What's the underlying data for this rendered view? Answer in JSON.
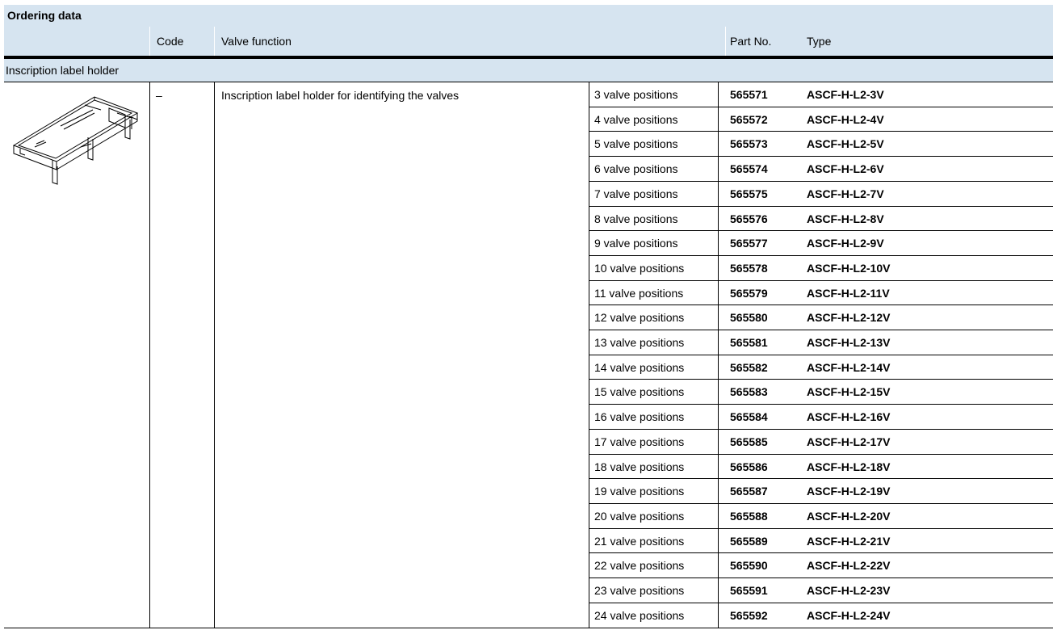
{
  "table": {
    "title": "Ordering data",
    "headers": {
      "code": "Code",
      "valve_function": "Valve function",
      "part_no": "Part No.",
      "type": "Type"
    },
    "section_label": "Inscription label holder",
    "code_value": "–",
    "description": "Inscription label holder for identifying the valves",
    "rows": [
      {
        "positions": "3 valve positions",
        "part_no": "565571",
        "type": "ASCF-H-L2-3V"
      },
      {
        "positions": "4 valve positions",
        "part_no": "565572",
        "type": "ASCF-H-L2-4V"
      },
      {
        "positions": "5 valve positions",
        "part_no": "565573",
        "type": "ASCF-H-L2-5V"
      },
      {
        "positions": "6 valve positions",
        "part_no": "565574",
        "type": "ASCF-H-L2-6V"
      },
      {
        "positions": "7 valve positions",
        "part_no": "565575",
        "type": "ASCF-H-L2-7V"
      },
      {
        "positions": "8 valve positions",
        "part_no": "565576",
        "type": "ASCF-H-L2-8V"
      },
      {
        "positions": "9 valve positions",
        "part_no": "565577",
        "type": "ASCF-H-L2-9V"
      },
      {
        "positions": "10 valve positions",
        "part_no": "565578",
        "type": "ASCF-H-L2-10V"
      },
      {
        "positions": "11 valve positions",
        "part_no": "565579",
        "type": "ASCF-H-L2-11V"
      },
      {
        "positions": "12 valve positions",
        "part_no": "565580",
        "type": "ASCF-H-L2-12V"
      },
      {
        "positions": "13 valve positions",
        "part_no": "565581",
        "type": "ASCF-H-L2-13V"
      },
      {
        "positions": "14 valve positions",
        "part_no": "565582",
        "type": "ASCF-H-L2-14V"
      },
      {
        "positions": "15 valve positions",
        "part_no": "565583",
        "type": "ASCF-H-L2-15V"
      },
      {
        "positions": "16 valve positions",
        "part_no": "565584",
        "type": "ASCF-H-L2-16V"
      },
      {
        "positions": "17 valve positions",
        "part_no": "565585",
        "type": "ASCF-H-L2-17V"
      },
      {
        "positions": "18 valve positions",
        "part_no": "565586",
        "type": "ASCF-H-L2-18V"
      },
      {
        "positions": "19 valve positions",
        "part_no": "565587",
        "type": "ASCF-H-L2-19V"
      },
      {
        "positions": "20 valve positions",
        "part_no": "565588",
        "type": "ASCF-H-L2-20V"
      },
      {
        "positions": "21 valve positions",
        "part_no": "565589",
        "type": "ASCF-H-L2-21V"
      },
      {
        "positions": "22 valve positions",
        "part_no": "565590",
        "type": "ASCF-H-L2-22V"
      },
      {
        "positions": "23 valve positions",
        "part_no": "565591",
        "type": "ASCF-H-L2-23V"
      },
      {
        "positions": "24 valve positions",
        "part_no": "565592",
        "type": "ASCF-H-L2-24V"
      }
    ]
  },
  "colors": {
    "header_bg": "#d6e4f0",
    "rule": "#000000"
  },
  "icons": {
    "product_image": "inscription-label-holder-drawing"
  }
}
